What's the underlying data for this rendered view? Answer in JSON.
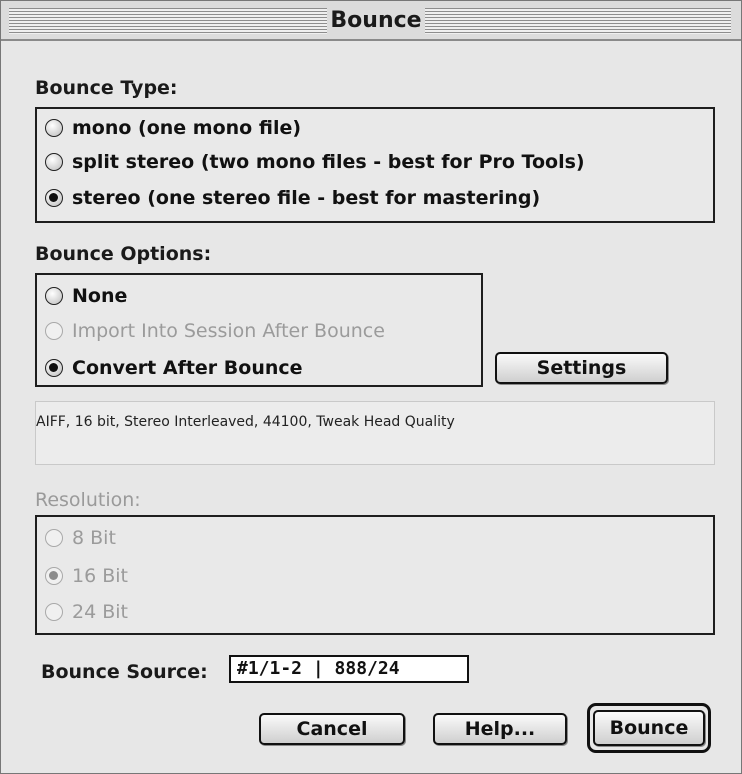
{
  "window": {
    "title": "Bounce"
  },
  "bounce_type": {
    "label": "Bounce Type:",
    "options": [
      {
        "label": "mono (one mono file)",
        "checked": false
      },
      {
        "label": "split stereo (two mono files - best for Pro Tools)",
        "checked": false
      },
      {
        "label": "stereo (one stereo file - best for mastering)",
        "checked": true
      }
    ]
  },
  "bounce_options": {
    "label": "Bounce Options:",
    "options": [
      {
        "label": "None",
        "checked": false,
        "enabled": true
      },
      {
        "label": "Import Into Session After Bounce",
        "checked": false,
        "enabled": false
      },
      {
        "label": "Convert After Bounce",
        "checked": true,
        "enabled": true
      }
    ],
    "settings_button": "Settings"
  },
  "conversion_info": "AIFF, 16 bit, Stereo Interleaved, 44100, Tweak Head Quality",
  "resolution": {
    "label": "Resolution:",
    "options": [
      {
        "label": "8 Bit",
        "checked": false
      },
      {
        "label": "16 Bit",
        "checked": true
      },
      {
        "label": "24 Bit",
        "checked": false
      }
    ]
  },
  "bounce_source": {
    "label": "Bounce Source:",
    "value": "#1/1-2 | 888/24"
  },
  "buttons": {
    "cancel": "Cancel",
    "help": "Help...",
    "bounce": "Bounce"
  }
}
